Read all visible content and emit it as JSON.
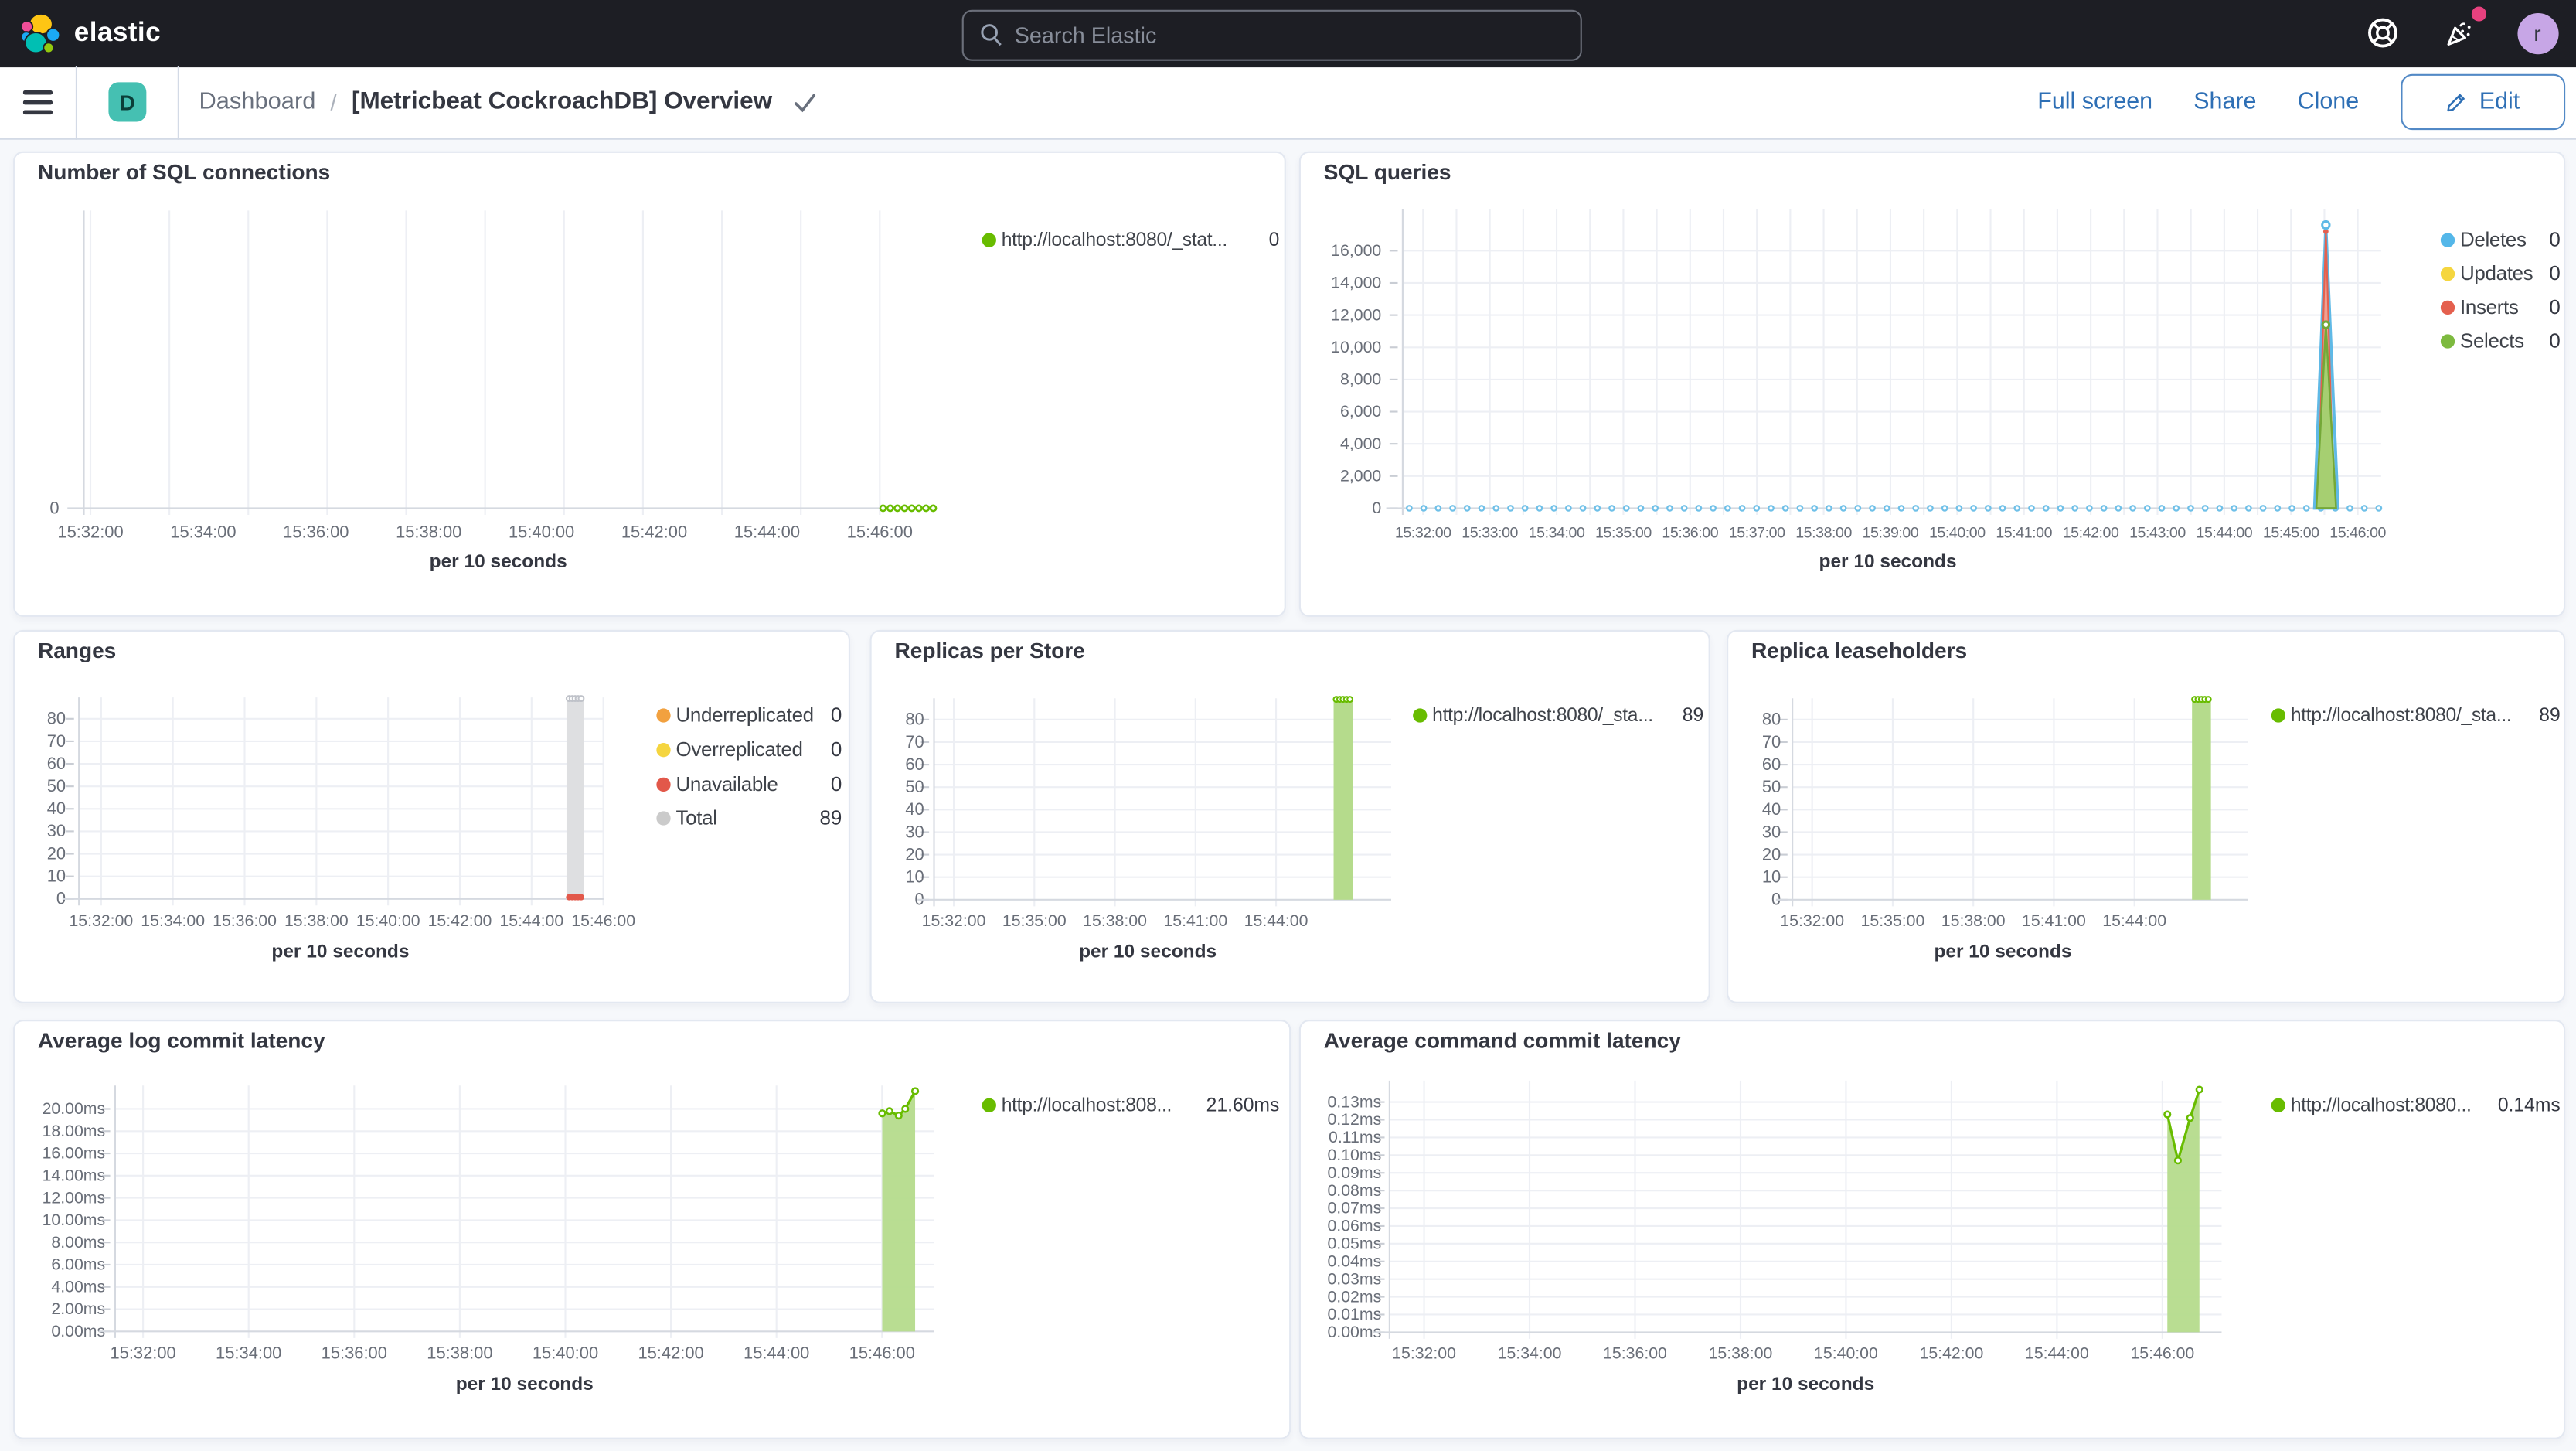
{
  "header": {
    "logo_text": "elastic",
    "search": {
      "placeholder": "Search Elastic"
    },
    "user_initial": "r",
    "notification_color": "#E7417E"
  },
  "toolbar": {
    "space_initial": "D",
    "breadcrumb": {
      "root": "Dashboard",
      "separator": "/",
      "current": "[Metricbeat CockroachDB] Overview"
    },
    "actions": {
      "full_screen": "Full screen",
      "share": "Share",
      "clone": "Clone",
      "edit": "Edit"
    }
  },
  "colors": {
    "header_bg": "#1D1E24",
    "link_blue": "#2E6FB5",
    "accent_green": "#68BC00",
    "teal_badge": "#45C0B2",
    "avatar_bg": "#C7A6E6"
  },
  "chart_data": [
    {
      "id": "number-of-sql-connections",
      "type": "line",
      "title": "Number of SQL connections",
      "xlabel": "per 10 seconds",
      "x_ticks": [
        "15:32:00",
        "15:34:00",
        "15:36:00",
        "15:38:00",
        "15:40:00",
        "15:42:00",
        "15:44:00",
        "15:46:00"
      ],
      "y_ticks": [
        "0"
      ],
      "ylim": [
        0,
        1
      ],
      "legend": [
        {
          "label": "http://localhost:8080/_stat...",
          "value": "0",
          "color": "#68BC00"
        }
      ],
      "series": [
        {
          "name": "http://localhost:8080/_stat...",
          "color": "#68BC00",
          "value": 0,
          "note": "flat at 0 from ~15:45:30 to 15:46:10"
        }
      ]
    },
    {
      "id": "sql-queries",
      "type": "area",
      "title": "SQL queries",
      "xlabel": "per 10 seconds",
      "x_ticks": [
        "15:32:00",
        "15:33:00",
        "15:34:00",
        "15:35:00",
        "15:36:00",
        "15:37:00",
        "15:38:00",
        "15:39:00",
        "15:40:00",
        "15:41:00",
        "15:42:00",
        "15:43:00",
        "15:44:00",
        "15:45:00",
        "15:46:00"
      ],
      "y_ticks": [
        "16,000",
        "14,000",
        "12,000",
        "10,000",
        "8,000",
        "6,000",
        "4,000",
        "2,000",
        "0"
      ],
      "ylim": [
        0,
        18600
      ],
      "legend": [
        {
          "label": "Deletes",
          "value": "0",
          "color": "#54B7E9"
        },
        {
          "label": "Updates",
          "value": "0",
          "color": "#F5D63F"
        },
        {
          "label": "Inserts",
          "value": "0",
          "color": "#E4604E"
        },
        {
          "label": "Selects",
          "value": "0",
          "color": "#7DBA3F"
        }
      ],
      "flatline": {
        "value": 0,
        "color": "#6FC0E8"
      },
      "spike": {
        "time": "15:45:50",
        "peaks": [
          {
            "name": "Deletes",
            "value": 17600,
            "stroke": "#5FB9E6",
            "fill": "#C3E5F6"
          },
          {
            "name": "Inserts",
            "value": 17200,
            "stroke": "#E4604E",
            "fill": "#EFA192"
          },
          {
            "name": "Selects",
            "value": 11400,
            "stroke": "#74A838",
            "fill": "#A6CF71"
          }
        ]
      }
    },
    {
      "id": "ranges",
      "type": "bar",
      "title": "Ranges",
      "xlabel": "per 10 seconds",
      "x_ticks": [
        "15:32:00",
        "15:34:00",
        "15:36:00",
        "15:38:00",
        "15:40:00",
        "15:42:00",
        "15:44:00",
        "15:46:00"
      ],
      "y_ticks": [
        "80",
        "70",
        "60",
        "50",
        "40",
        "30",
        "20",
        "10",
        "0"
      ],
      "ylim": [
        0,
        89.5
      ],
      "legend": [
        {
          "label": "Underreplicated",
          "value": "0",
          "color": "#F2A13F"
        },
        {
          "label": "Overreplicated",
          "value": "0",
          "color": "#F5D53F"
        },
        {
          "label": "Unavailable",
          "value": "0",
          "color": "#E2584A"
        },
        {
          "label": "Total",
          "value": "89",
          "color": "#CBCBCB"
        }
      ],
      "bar": {
        "time": "15:45:50",
        "value": 89,
        "fill": "#DEDFE1",
        "top_marker_color": "#BFC2C9",
        "bottom_marker_color": "#E2584A",
        "bottom_value": 0
      }
    },
    {
      "id": "replicas-per-store",
      "type": "bar",
      "title": "Replicas per Store",
      "xlabel": "per 10 seconds",
      "x_ticks": [
        "15:32:00",
        "15:35:00",
        "15:38:00",
        "15:41:00",
        "15:44:00"
      ],
      "y_ticks": [
        "80",
        "70",
        "60",
        "50",
        "40",
        "30",
        "20",
        "10",
        "0"
      ],
      "ylim": [
        0,
        89.5
      ],
      "legend": [
        {
          "label": "http://localhost:8080/_sta...",
          "value": "89",
          "color": "#68BC00"
        }
      ],
      "bar": {
        "time": "15:45:50",
        "value": 89,
        "fill": "#B5DB8C",
        "top_marker_color": "#68BC00"
      }
    },
    {
      "id": "replica-leaseholders",
      "type": "bar",
      "title": "Replica leaseholders",
      "xlabel": "per 10 seconds",
      "x_ticks": [
        "15:32:00",
        "15:35:00",
        "15:38:00",
        "15:41:00",
        "15:44:00"
      ],
      "y_ticks": [
        "80",
        "70",
        "60",
        "50",
        "40",
        "30",
        "20",
        "10",
        "0"
      ],
      "ylim": [
        0,
        89.5
      ],
      "legend": [
        {
          "label": "http://localhost:8080/_sta...",
          "value": "89",
          "color": "#68BC00"
        }
      ],
      "bar": {
        "time": "15:45:50",
        "value": 89,
        "fill": "#B5DB8C",
        "top_marker_color": "#68BC00"
      }
    },
    {
      "id": "average-log-commit-latency",
      "type": "area",
      "title": "Average log commit latency",
      "xlabel": "per 10 seconds",
      "x_ticks": [
        "15:32:00",
        "15:34:00",
        "15:36:00",
        "15:38:00",
        "15:40:00",
        "15:42:00",
        "15:44:00",
        "15:46:00"
      ],
      "y_ticks": [
        "20.00ms",
        "18.00ms",
        "16.00ms",
        "14.00ms",
        "12.00ms",
        "10.00ms",
        "8.00ms",
        "6.00ms",
        "4.00ms",
        "2.00ms",
        "0.00ms"
      ],
      "ylim": [
        0,
        22.1
      ],
      "legend": [
        {
          "label": "http://localhost:808...",
          "value": "21.60ms",
          "color": "#68BC00"
        }
      ],
      "area": {
        "start": "15:45:30",
        "end": "15:46:10",
        "points_ms": [
          19.6,
          19.8,
          19.4,
          20.0,
          21.6
        ],
        "stroke": "#68BC00",
        "fill": "#B5DB8C"
      }
    },
    {
      "id": "average-command-commit-latency",
      "type": "area",
      "title": "Average command commit latency",
      "xlabel": "per 10 seconds",
      "x_ticks": [
        "15:32:00",
        "15:34:00",
        "15:36:00",
        "15:38:00",
        "15:40:00",
        "15:42:00",
        "15:44:00",
        "15:46:00"
      ],
      "y_ticks": [
        "0.13ms",
        "0.12ms",
        "0.11ms",
        "0.10ms",
        "0.09ms",
        "0.08ms",
        "0.07ms",
        "0.06ms",
        "0.05ms",
        "0.04ms",
        "0.03ms",
        "0.02ms",
        "0.01ms",
        "0.00ms"
      ],
      "ylim": [
        0,
        0.1421
      ],
      "legend": [
        {
          "label": "http://localhost:8080...",
          "value": "0.14ms",
          "color": "#68BC00"
        }
      ],
      "area": {
        "start": "15:45:30",
        "end": "15:46:10",
        "points_ms": [
          0.123,
          0.097,
          0.121,
          0.137
        ],
        "stroke": "#68BC00",
        "fill": "#B5DB8C"
      }
    }
  ]
}
